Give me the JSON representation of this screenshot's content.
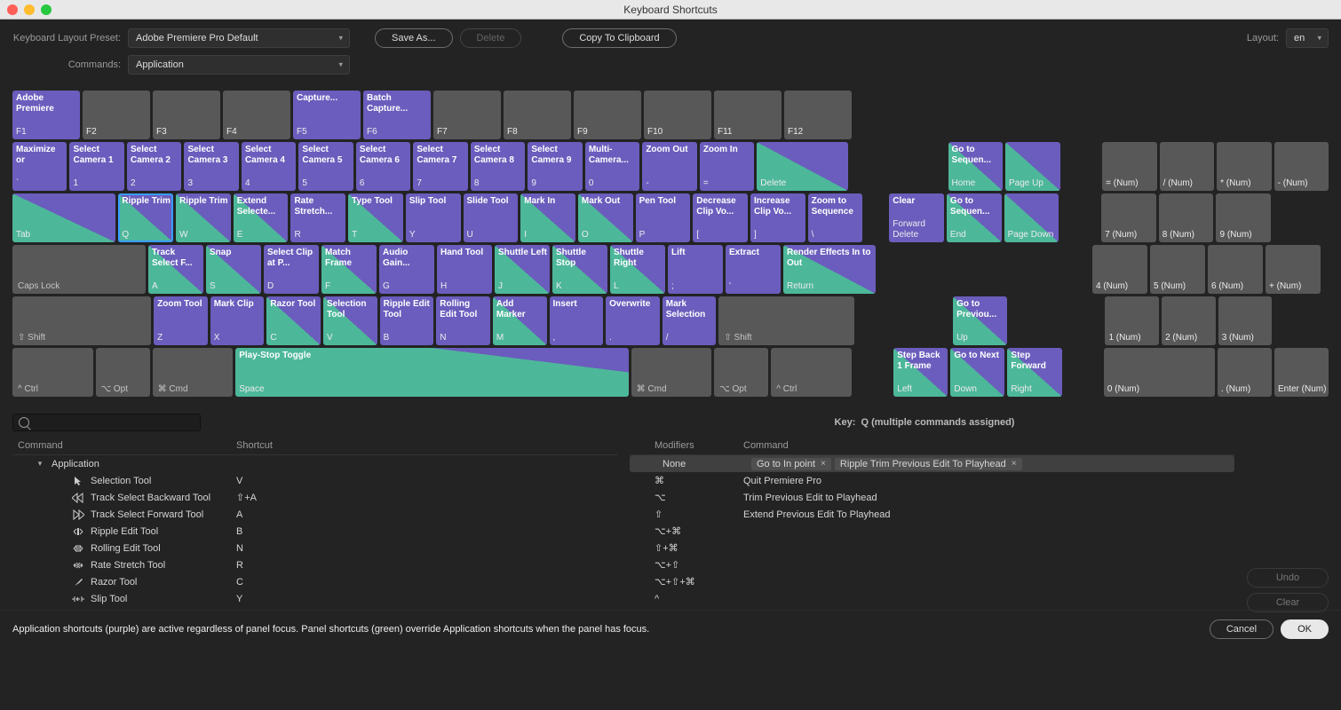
{
  "window": {
    "title": "Keyboard Shortcuts"
  },
  "controls": {
    "preset_label": "Keyboard Layout Preset:",
    "preset_value": "Adobe Premiere Pro Default",
    "commands_label": "Commands:",
    "commands_value": "Application",
    "save_as": "Save As...",
    "delete": "Delete",
    "copy": "Copy To Clipboard",
    "layout_label": "Layout:",
    "layout_value": "en"
  },
  "keyboard": {
    "fn_row": [
      {
        "cmd": "Adobe Premiere",
        "ch": "F1",
        "style": "purple"
      },
      {
        "cmd": "",
        "ch": "F2",
        "style": "gray"
      },
      {
        "cmd": "",
        "ch": "F3",
        "style": "gray"
      },
      {
        "cmd": "",
        "ch": "F4",
        "style": "gray"
      },
      {
        "cmd": "Capture...",
        "ch": "F5",
        "style": "purple"
      },
      {
        "cmd": "Batch Capture...",
        "ch": "F6",
        "style": "purple"
      },
      {
        "cmd": "",
        "ch": "F7",
        "style": "gray"
      },
      {
        "cmd": "",
        "ch": "F8",
        "style": "gray"
      },
      {
        "cmd": "",
        "ch": "F9",
        "style": "gray"
      },
      {
        "cmd": "",
        "ch": "F10",
        "style": "gray"
      },
      {
        "cmd": "",
        "ch": "F11",
        "style": "gray"
      },
      {
        "cmd": "",
        "ch": "F12",
        "style": "gray"
      }
    ],
    "num_row": [
      {
        "cmd": "Maximize or",
        "ch": "`",
        "style": "purple",
        "w": "w1"
      },
      {
        "cmd": "Select Camera 1",
        "ch": "1",
        "style": "purple",
        "w": "w1"
      },
      {
        "cmd": "Select Camera 2",
        "ch": "2",
        "style": "purple",
        "w": "w1"
      },
      {
        "cmd": "Select Camera 3",
        "ch": "3",
        "style": "purple",
        "w": "w1"
      },
      {
        "cmd": "Select Camera 4",
        "ch": "4",
        "style": "purple",
        "w": "w1"
      },
      {
        "cmd": "Select Camera 5",
        "ch": "5",
        "style": "purple",
        "w": "w1"
      },
      {
        "cmd": "Select Camera 6",
        "ch": "6",
        "style": "purple",
        "w": "w1"
      },
      {
        "cmd": "Select Camera 7",
        "ch": "7",
        "style": "purple",
        "w": "w1"
      },
      {
        "cmd": "Select Camera 8",
        "ch": "8",
        "style": "purple",
        "w": "w1"
      },
      {
        "cmd": "Select Camera 9",
        "ch": "9",
        "style": "purple",
        "w": "w1"
      },
      {
        "cmd": "Multi-Camera...",
        "ch": "0",
        "style": "purple",
        "w": "w1"
      },
      {
        "cmd": "Zoom Out",
        "ch": "-",
        "style": "purple",
        "w": "w1"
      },
      {
        "cmd": "Zoom In",
        "ch": "=",
        "style": "purple",
        "w": "w1"
      },
      {
        "cmd": "",
        "ch": "Delete",
        "style": "split",
        "w": "wEnt"
      }
    ],
    "num_row_nav": [
      {
        "cmd": "Go to Sequen...",
        "ch": "Home",
        "style": "split",
        "w": "w1"
      },
      {
        "cmd": "",
        "ch": "Page Up",
        "style": "split",
        "w": "w1"
      }
    ],
    "num_row_pad": [
      {
        "cmd": "",
        "ch": "= (Num)",
        "style": "gray",
        "w": "w1"
      },
      {
        "cmd": "",
        "ch": "/ (Num)",
        "style": "gray",
        "w": "w1"
      },
      {
        "cmd": "",
        "ch": "* (Num)",
        "style": "gray",
        "w": "w1"
      },
      {
        "cmd": "",
        "ch": "- (Num)",
        "style": "gray",
        "w": "w1"
      }
    ],
    "q_row": [
      {
        "cmd": "",
        "ch": "Tab",
        "style": "split",
        "w": "wTab"
      },
      {
        "cmd": "Ripple Trim",
        "ch": "Q",
        "style": "split",
        "w": "w1",
        "sel": true
      },
      {
        "cmd": "Ripple Trim",
        "ch": "W",
        "style": "split",
        "w": "w1"
      },
      {
        "cmd": "Extend Selecte...",
        "ch": "E",
        "style": "split",
        "w": "w1"
      },
      {
        "cmd": "Rate Stretch...",
        "ch": "R",
        "style": "purple",
        "w": "w1"
      },
      {
        "cmd": "Type Tool",
        "ch": "T",
        "style": "split",
        "w": "w1"
      },
      {
        "cmd": "Slip Tool",
        "ch": "Y",
        "style": "purple",
        "w": "w1"
      },
      {
        "cmd": "Slide Tool",
        "ch": "U",
        "style": "purple",
        "w": "w1"
      },
      {
        "cmd": "Mark In",
        "ch": "I",
        "style": "split",
        "w": "w1"
      },
      {
        "cmd": "Mark Out",
        "ch": "O",
        "style": "split",
        "w": "w1"
      },
      {
        "cmd": "Pen Tool",
        "ch": "P",
        "style": "purple",
        "w": "w1"
      },
      {
        "cmd": "Decrease Clip Vo...",
        "ch": "[",
        "style": "purple",
        "w": "w1"
      },
      {
        "cmd": "Increase Clip Vo...",
        "ch": "]",
        "style": "purple",
        "w": "w1"
      },
      {
        "cmd": "Zoom to Sequence",
        "ch": "\\",
        "style": "purple",
        "w": "w1"
      }
    ],
    "q_row_nav": [
      {
        "cmd": "Clear",
        "ch": "Forward Delete",
        "style": "purple",
        "w": "w1"
      },
      {
        "cmd": "Go to Sequen...",
        "ch": "End",
        "style": "split",
        "w": "w1"
      },
      {
        "cmd": "",
        "ch": "Page Down",
        "style": "split",
        "w": "w1"
      }
    ],
    "q_row_pad": [
      {
        "cmd": "",
        "ch": "7 (Num)",
        "style": "gray",
        "w": "w1"
      },
      {
        "cmd": "",
        "ch": "8 (Num)",
        "style": "gray",
        "w": "w1"
      },
      {
        "cmd": "",
        "ch": "9 (Num)",
        "style": "gray",
        "w": "w1"
      }
    ],
    "a_row": [
      {
        "cmd": "",
        "ch": "Caps Lock",
        "style": "gray",
        "w": "wCaps",
        "mod": true
      },
      {
        "cmd": "Track Select F...",
        "ch": "A",
        "style": "split",
        "w": "w1"
      },
      {
        "cmd": "Snap",
        "ch": "S",
        "style": "split",
        "w": "w1"
      },
      {
        "cmd": "Select Clip at P...",
        "ch": "D",
        "style": "purple",
        "w": "w1"
      },
      {
        "cmd": "Match Frame",
        "ch": "F",
        "style": "split",
        "w": "w1"
      },
      {
        "cmd": "Audio Gain...",
        "ch": "G",
        "style": "purple",
        "w": "w1"
      },
      {
        "cmd": "Hand Tool",
        "ch": "H",
        "style": "purple",
        "w": "w1"
      },
      {
        "cmd": "Shuttle Left",
        "ch": "J",
        "style": "split",
        "w": "w1"
      },
      {
        "cmd": "Shuttle Stop",
        "ch": "K",
        "style": "split",
        "w": "w1"
      },
      {
        "cmd": "Shuttle Right",
        "ch": "L",
        "style": "split",
        "w": "w1"
      },
      {
        "cmd": "Lift",
        "ch": ";",
        "style": "purple",
        "w": "w1"
      },
      {
        "cmd": "Extract",
        "ch": "'",
        "style": "purple",
        "w": "w1"
      },
      {
        "cmd": "Render Effects In to Out",
        "ch": "Return",
        "style": "split",
        "w": "wEnt"
      }
    ],
    "a_row_pad": [
      {
        "cmd": "",
        "ch": "4 (Num)",
        "style": "gray",
        "w": "w1"
      },
      {
        "cmd": "",
        "ch": "5 (Num)",
        "style": "gray",
        "w": "w1"
      },
      {
        "cmd": "",
        "ch": "6 (Num)",
        "style": "gray",
        "w": "w1"
      },
      {
        "cmd": "",
        "ch": "+ (Num)",
        "style": "gray",
        "w": "w1"
      }
    ],
    "z_row": [
      {
        "cmd": "",
        "ch": "⇧ Shift",
        "style": "gray",
        "w": "wShift",
        "mod": true
      },
      {
        "cmd": "Zoom Tool",
        "ch": "Z",
        "style": "purple",
        "w": "w1"
      },
      {
        "cmd": "Mark Clip",
        "ch": "X",
        "style": "purple",
        "w": "w1"
      },
      {
        "cmd": "Razor Tool",
        "ch": "C",
        "style": "split",
        "w": "w1"
      },
      {
        "cmd": "Selection Tool",
        "ch": "V",
        "style": "split",
        "w": "w1"
      },
      {
        "cmd": "Ripple Edit Tool",
        "ch": "B",
        "style": "purple",
        "w": "w1"
      },
      {
        "cmd": "Rolling Edit Tool",
        "ch": "N",
        "style": "purple",
        "w": "w1"
      },
      {
        "cmd": "Add Marker",
        "ch": "M",
        "style": "split",
        "w": "w1"
      },
      {
        "cmd": "Insert",
        "ch": ",",
        "style": "purple",
        "w": "w1"
      },
      {
        "cmd": "Overwrite",
        "ch": ".",
        "style": "purple",
        "w": "w1"
      },
      {
        "cmd": "Mark Selection",
        "ch": "/",
        "style": "purple",
        "w": "w1"
      },
      {
        "cmd": "",
        "ch": "⇧ Shift",
        "style": "gray",
        "w": "wShiftR",
        "mod": true
      }
    ],
    "z_row_nav": [
      {
        "cmd": "Go to Previou...",
        "ch": "Up",
        "style": "split",
        "w": "w1"
      }
    ],
    "z_row_pad": [
      {
        "cmd": "",
        "ch": "1 (Num)",
        "style": "gray",
        "w": "w1"
      },
      {
        "cmd": "",
        "ch": "2 (Num)",
        "style": "gray",
        "w": "w1"
      },
      {
        "cmd": "",
        "ch": "3 (Num)",
        "style": "gray",
        "w": "w1"
      }
    ],
    "sp_row": [
      {
        "cmd": "",
        "ch": "^ Ctrl",
        "style": "gray",
        "w": "wCtrl",
        "mod": true
      },
      {
        "cmd": "",
        "ch": "⌥ Opt",
        "style": "gray",
        "w": "w1",
        "mod": true
      },
      {
        "cmd": "",
        "ch": "⌘ Cmd",
        "style": "gray",
        "w": "wCtrl",
        "mod": true
      },
      {
        "cmd": "Play-Stop Toggle",
        "ch": "Space",
        "style": "space-split",
        "w": "wSpace"
      },
      {
        "cmd": "",
        "ch": "⌘ Cmd",
        "style": "gray",
        "w": "wCtrl",
        "mod": true
      },
      {
        "cmd": "",
        "ch": "⌥ Opt",
        "style": "gray",
        "w": "w1",
        "mod": true
      },
      {
        "cmd": "",
        "ch": "^ Ctrl",
        "style": "gray",
        "w": "wCtrl",
        "mod": true
      }
    ],
    "sp_row_nav": [
      {
        "cmd": "Step Back 1 Frame",
        "ch": "Left",
        "style": "split",
        "w": "w1"
      },
      {
        "cmd": "Go to Next",
        "ch": "Down",
        "style": "split",
        "w": "w1"
      },
      {
        "cmd": "Step Forward",
        "ch": "Right",
        "style": "split",
        "w": "w1"
      }
    ],
    "sp_row_pad": [
      {
        "cmd": "",
        "ch": "0 (Num)",
        "style": "gray",
        "w": "w2"
      },
      {
        "cmd": "",
        "ch": ". (Num)",
        "style": "gray",
        "w": "w1"
      },
      {
        "cmd": "",
        "ch": "Enter (Num)",
        "style": "gray",
        "w": "w1"
      }
    ]
  },
  "status": {
    "key_label": "Key:",
    "key_text": "Q (multiple commands assigned)"
  },
  "left_panel": {
    "h1": "Command",
    "h2": "Shortcut",
    "app_label": "Application",
    "rows": [
      {
        "name": "Selection Tool",
        "sc": "V",
        "icon": "arrow"
      },
      {
        "name": "Track Select Backward Tool",
        "sc": "⇧+A",
        "icon": "tsbwd"
      },
      {
        "name": "Track Select Forward Tool",
        "sc": "A",
        "icon": "tsfwd"
      },
      {
        "name": "Ripple Edit Tool",
        "sc": "B",
        "icon": "ripple"
      },
      {
        "name": "Rolling Edit Tool",
        "sc": "N",
        "icon": "roll"
      },
      {
        "name": "Rate Stretch Tool",
        "sc": "R",
        "icon": "rate"
      },
      {
        "name": "Razor Tool",
        "sc": "C",
        "icon": "razor"
      },
      {
        "name": "Slip Tool",
        "sc": "Y",
        "icon": "slip"
      }
    ]
  },
  "right_panel": {
    "h1": "Modifiers",
    "h2": "Command",
    "rows": [
      {
        "mod": "None",
        "chips": [
          "Go to In point",
          "Ripple Trim Previous Edit To Playhead"
        ],
        "sel": true
      },
      {
        "mod": "⌘",
        "txt": "Quit Premiere Pro"
      },
      {
        "mod": "⌥",
        "txt": "Trim Previous Edit to Playhead"
      },
      {
        "mod": "⇧",
        "txt": "Extend Previous Edit To Playhead"
      },
      {
        "mod": "⌥+⌘",
        "txt": ""
      },
      {
        "mod": "⇧+⌘",
        "txt": ""
      },
      {
        "mod": "⌥+⇧",
        "txt": ""
      },
      {
        "mod": "⌥+⇧+⌘",
        "txt": ""
      },
      {
        "mod": "^",
        "txt": ""
      }
    ],
    "undo": "Undo",
    "clear": "Clear"
  },
  "footer": {
    "hint": "Application shortcuts (purple) are active regardless of panel focus. Panel shortcuts (green) override Application shortcuts when the panel has focus.",
    "cancel": "Cancel",
    "ok": "OK"
  }
}
